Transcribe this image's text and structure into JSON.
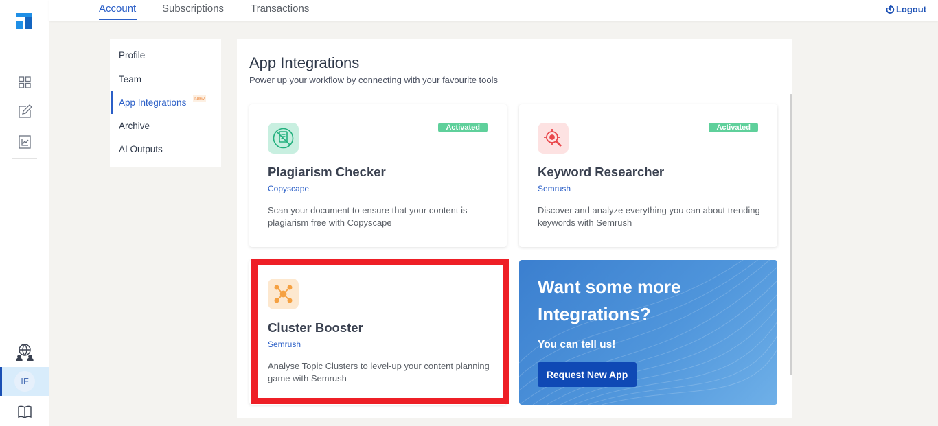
{
  "topbar": {
    "tabs": [
      {
        "label": "Account",
        "active": true
      },
      {
        "label": "Subscriptions",
        "active": false
      },
      {
        "label": "Transactions",
        "active": false
      }
    ],
    "logout_label": "Logout"
  },
  "rail": {
    "icons": [
      "logo-icon",
      "dashboard-grid-icon",
      "edit-document-icon",
      "analytics-chart-icon",
      "community-globe-icon",
      "book-icon"
    ],
    "avatar_initials": "IF"
  },
  "menu": {
    "items": [
      {
        "label": "Profile"
      },
      {
        "label": "Team"
      },
      {
        "label": "App Integrations",
        "active": true,
        "badge": "New"
      },
      {
        "label": "Archive"
      },
      {
        "label": "AI Outputs"
      }
    ]
  },
  "panel": {
    "title": "App Integrations",
    "subtitle": "Power up your workflow by connecting with your favourite tools"
  },
  "apps": [
    {
      "name": "Plagiarism Checker",
      "vendor": "Copyscape",
      "description": "Scan your document to ensure that your content is plagiarism free with Copyscape",
      "status": "Activated",
      "icon": "plagiarism-document-icon"
    },
    {
      "name": "Keyword Researcher",
      "vendor": "Semrush",
      "description": "Discover and analyze everything you can about trending keywords with Semrush",
      "status": "Activated",
      "icon": "keyword-target-icon"
    },
    {
      "name": "Cluster Booster",
      "vendor": "Semrush",
      "description": "Analyse Topic Clusters to level-up your content planning game with Semrush",
      "status": "",
      "icon": "cluster-network-icon"
    }
  ],
  "promo": {
    "title": "Want some more Integrations?",
    "subtitle": "You can tell us!",
    "button_label": "Request New App"
  },
  "colors": {
    "accent": "#2b5fc7",
    "activated": "#5fd09b",
    "highlight": "#ee1f26",
    "promo_button": "#0f49b5"
  }
}
